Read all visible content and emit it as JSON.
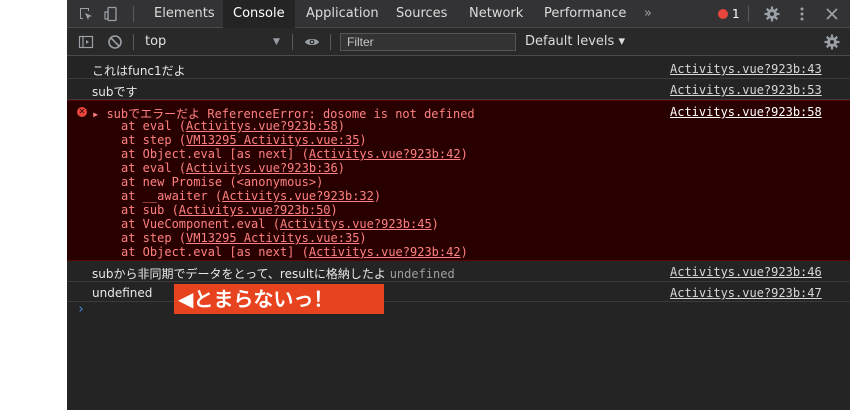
{
  "tabs": [
    {
      "label": "Elements",
      "active": false
    },
    {
      "label": "Console",
      "active": true
    },
    {
      "label": "Application",
      "active": false
    },
    {
      "label": "Sources",
      "active": false
    },
    {
      "label": "Network",
      "active": false
    },
    {
      "label": "Performance",
      "active": false
    }
  ],
  "more_tabs_label": "»",
  "error_count": "1",
  "toolbar": {
    "context": "top",
    "filter_placeholder": "Filter",
    "levels_label": "Default levels ▾"
  },
  "messages": [
    {
      "text": "これはfunc1だよ",
      "source": "Activitys.vue?923b:43"
    },
    {
      "text": "subです",
      "source": "Activitys.vue?923b:53"
    }
  ],
  "error": {
    "head": "▸ subでエラーだよ ReferenceError: dosome is not defined",
    "source": "Activitys.vue?923b:58",
    "stack": [
      {
        "pre": "at eval (",
        "link": "Activitys.vue?923b:58",
        "post": ")"
      },
      {
        "pre": "at step (",
        "link": "VM13295 Activitys.vue:35",
        "post": ")"
      },
      {
        "pre": "at Object.eval [as next] (",
        "link": "Activitys.vue?923b:42",
        "post": ")"
      },
      {
        "pre": "at eval (",
        "link": "Activitys.vue?923b:36",
        "post": ")"
      },
      {
        "pre": "at new Promise (<anonymous>)",
        "link": "",
        "post": ""
      },
      {
        "pre": "at __awaiter (",
        "link": "Activitys.vue?923b:32",
        "post": ")"
      },
      {
        "pre": "at sub (",
        "link": "Activitys.vue?923b:50",
        "post": ")"
      },
      {
        "pre": "at VueComponent.eval (",
        "link": "Activitys.vue?923b:45",
        "post": ")"
      },
      {
        "pre": "at step (",
        "link": "VM13295 Activitys.vue:35",
        "post": ")"
      },
      {
        "pre": "at Object.eval [as next] (",
        "link": "Activitys.vue?923b:42",
        "post": ")"
      }
    ]
  },
  "after": [
    {
      "text": "subから非同期でデータをとって、resultに格納したよ",
      "extra": "undefined",
      "source": "Activitys.vue?923b:46"
    },
    {
      "text": "",
      "extra": "undefined",
      "source": "Activitys.vue?923b:47"
    }
  ],
  "prompt_symbol": "›",
  "overlay_text": "◀とまらないっ！",
  "colors": {
    "error": "#e8453c",
    "error_bg": "#290000",
    "overlay": "#e8431f",
    "prompt": "#4a90e2"
  }
}
